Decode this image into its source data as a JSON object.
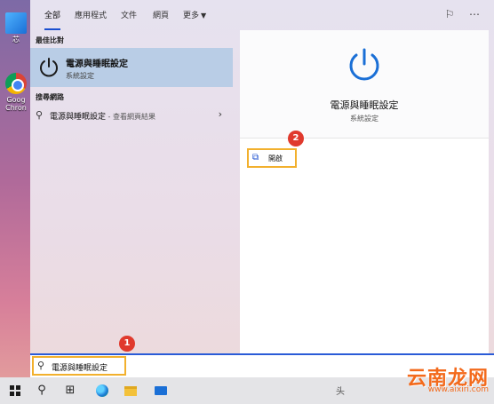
{
  "desktop": {
    "icons": [
      {
        "name": "this-pc",
        "label": "芯"
      },
      {
        "name": "chrome",
        "label": "Goog Chron"
      }
    ]
  },
  "tabs": [
    {
      "label": "全部",
      "active": true
    },
    {
      "label": "應用程式"
    },
    {
      "label": "文件"
    },
    {
      "label": "網頁"
    },
    {
      "label": "更多",
      "dropdown": true
    }
  ],
  "left": {
    "best_match_header": "最佳比對",
    "best_match": {
      "title": "電源與睡眠設定",
      "subtitle": "系統設定",
      "icon": "power-icon"
    },
    "web_header": "搜尋網路",
    "web_result": {
      "query": "電源與睡眠設定",
      "suffix": " - 查看網頁結果"
    }
  },
  "right": {
    "title": "電源與睡眠設定",
    "subtitle": "系統設定",
    "open_label": "開啟"
  },
  "search": {
    "value": "電源與睡眠設定"
  },
  "annotations": {
    "step1": "1",
    "step2": "2"
  },
  "watermark": {
    "brand": "云南龙网",
    "url": "www.aixiri.com",
    "prefix": "头"
  },
  "colors": {
    "accent": "#1a4fd0",
    "highlight": "#f2b02d",
    "badge": "#e0392d"
  }
}
